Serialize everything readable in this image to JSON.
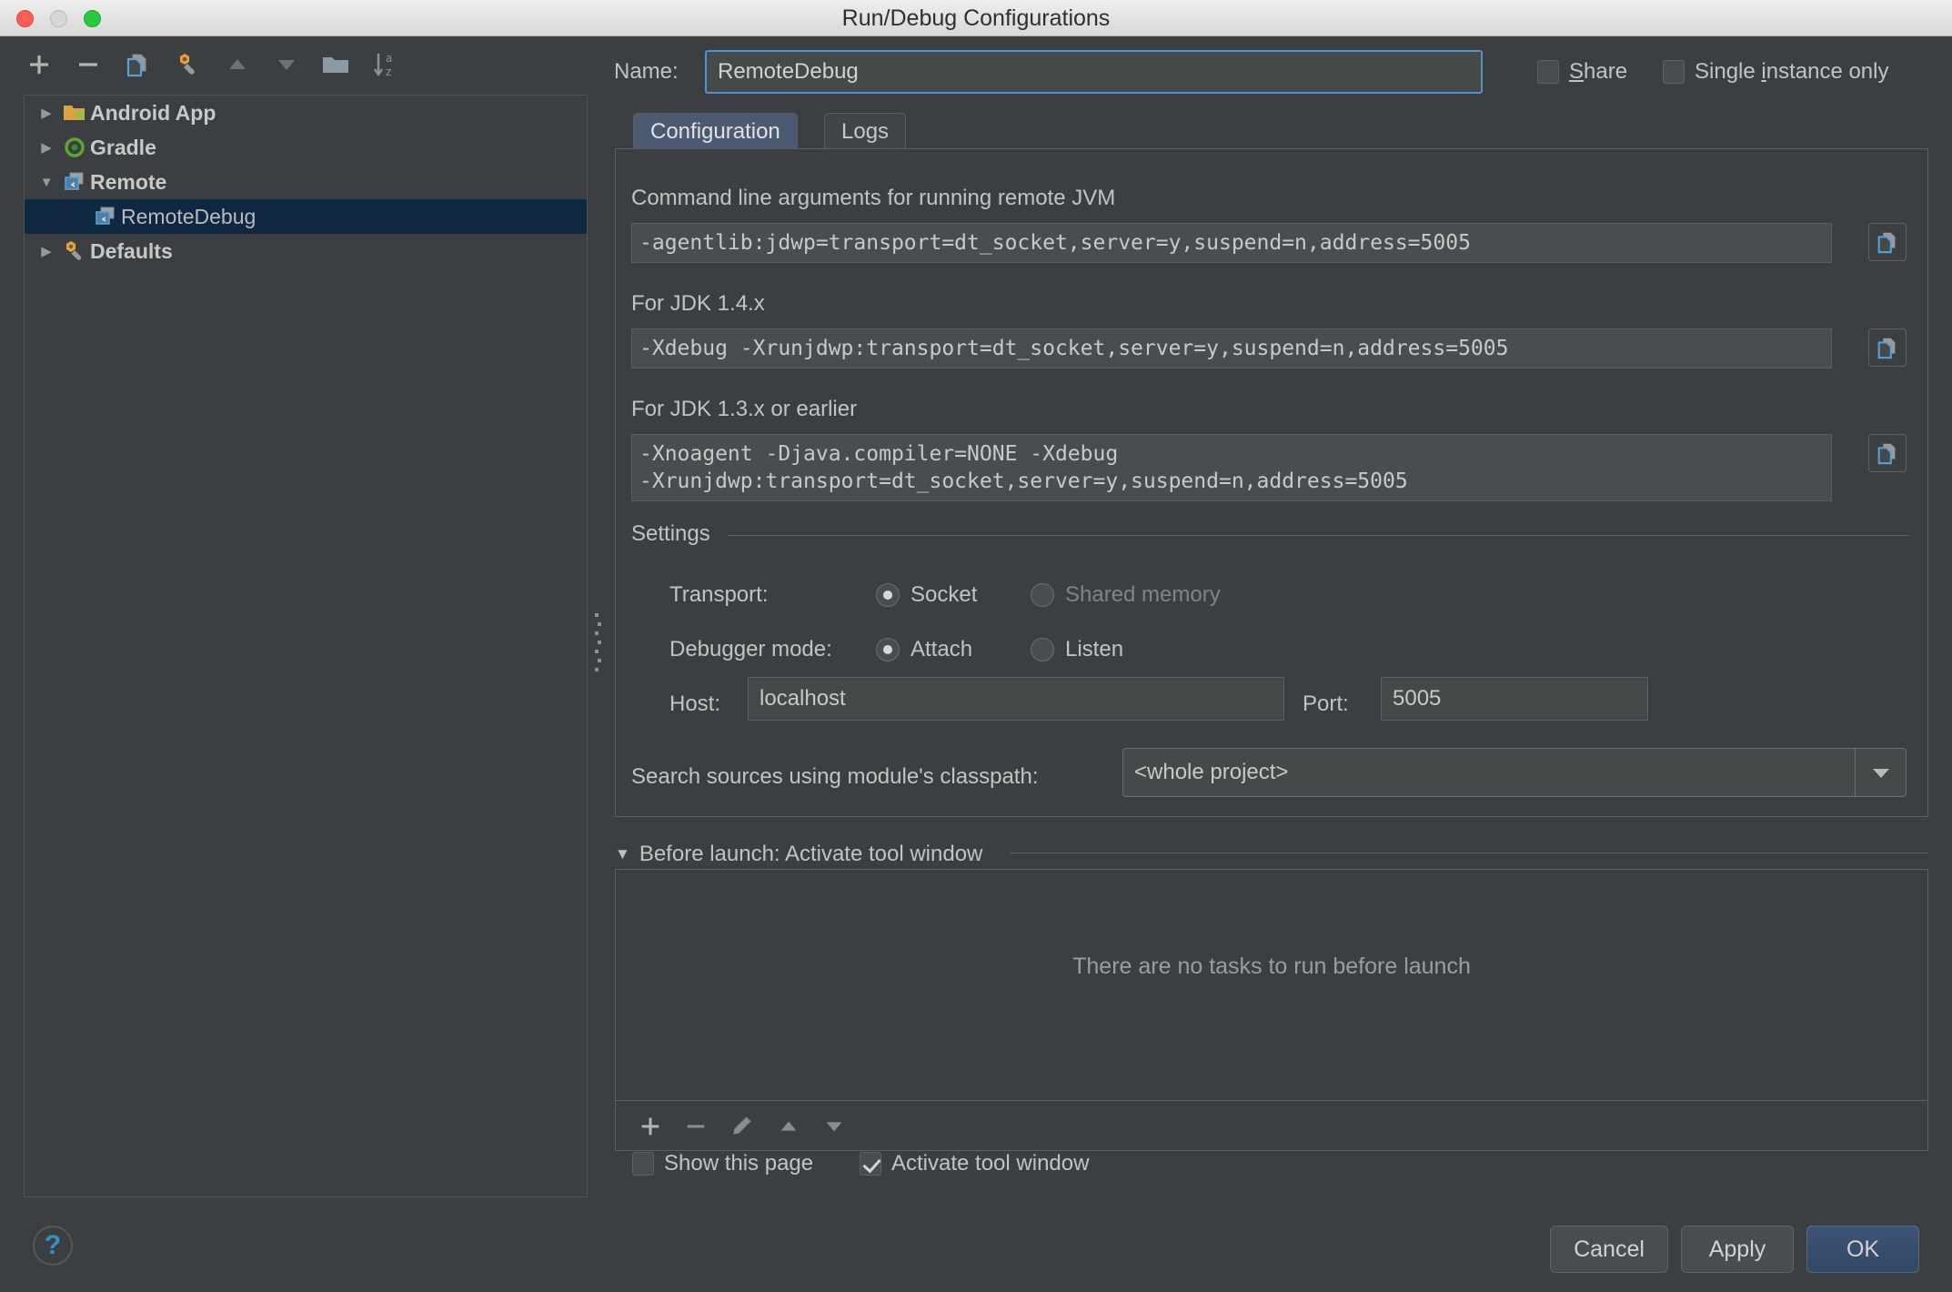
{
  "window": {
    "title": "Run/Debug Configurations",
    "traffic_lights": [
      "close",
      "minimize",
      "maximize"
    ]
  },
  "sidebar": {
    "toolbar": [
      {
        "name": "add-configuration-button",
        "icon": "plus-icon"
      },
      {
        "name": "remove-configuration-button",
        "icon": "minus-icon"
      },
      {
        "name": "copy-configuration-button",
        "icon": "copy-icon"
      },
      {
        "name": "edit-defaults-button",
        "icon": "wrench-icon"
      },
      {
        "name": "move-up-button",
        "icon": "arrow-up-icon"
      },
      {
        "name": "move-down-button",
        "icon": "arrow-down-icon"
      },
      {
        "name": "new-folder-button",
        "icon": "folder-icon"
      },
      {
        "name": "sort-button",
        "icon": "sort-az-icon"
      }
    ],
    "tree": [
      {
        "label": "Android App",
        "icon": "android-app-icon",
        "expanded": false,
        "level": 0,
        "bold": true,
        "selected": false
      },
      {
        "label": "Gradle",
        "icon": "gradle-icon",
        "expanded": false,
        "level": 0,
        "bold": true,
        "selected": false
      },
      {
        "label": "Remote",
        "icon": "remote-icon",
        "expanded": true,
        "level": 0,
        "bold": true,
        "selected": false
      },
      {
        "label": "RemoteDebug",
        "icon": "remote-icon",
        "expanded": null,
        "level": 1,
        "bold": false,
        "selected": true
      },
      {
        "label": "Defaults",
        "icon": "wrench-icon",
        "expanded": false,
        "level": 0,
        "bold": true,
        "selected": false
      }
    ]
  },
  "header": {
    "name_label": "Name:",
    "name_value": "RemoteDebug",
    "share_label": "Share",
    "share_mnemonic": "S",
    "share_checked": false,
    "single_instance_label": "Single instance only",
    "single_instance_mnemonic": "i",
    "single_instance_checked": false
  },
  "tabs": [
    {
      "label": "Configuration",
      "active": true
    },
    {
      "label": "Logs",
      "active": false
    }
  ],
  "configuration": {
    "cmdline_label": "Command line arguments for running remote JVM",
    "cmdline_value": "-agentlib:jdwp=transport=dt_socket,server=y,suspend=n,address=5005",
    "jdk14_label": "For JDK 1.4.x",
    "jdk14_value": "-Xdebug -Xrunjdwp:transport=dt_socket,server=y,suspend=n,address=5005",
    "jdk13_label": "For JDK 1.3.x or earlier",
    "jdk13_value": "-Xnoagent -Djava.compiler=NONE -Xdebug\n-Xrunjdwp:transport=dt_socket,server=y,suspend=n,address=5005",
    "copy_icon": "copy-to-clipboard-icon",
    "settings_title": "Settings",
    "transport_label": "Transport:",
    "transport_options": [
      {
        "label": "Socket",
        "selected": true,
        "disabled": false
      },
      {
        "label": "Shared memory",
        "selected": false,
        "disabled": true
      }
    ],
    "debugger_mode_label": "Debugger mode:",
    "debugger_mode_options": [
      {
        "label": "Attach",
        "selected": true,
        "disabled": false
      },
      {
        "label": "Listen",
        "selected": false,
        "disabled": false
      }
    ],
    "host_label": "Host:",
    "host_value": "localhost",
    "port_label": "Port:",
    "port_value": "5005",
    "classpath_label": "Search sources using module's classpath:",
    "classpath_value": "<whole project>",
    "classpath_arrow": "chevron-down-icon"
  },
  "before_launch": {
    "title": "Before launch: Activate tool window",
    "collapse_icon": "triangle-down-icon",
    "empty_text": "There are no tasks to run before launch",
    "toolbar": [
      {
        "name": "add-task-button",
        "icon": "plus-icon"
      },
      {
        "name": "remove-task-button",
        "icon": "minus-icon"
      },
      {
        "name": "edit-task-button",
        "icon": "pencil-icon"
      },
      {
        "name": "move-task-up-button",
        "icon": "arrow-up-icon"
      },
      {
        "name": "move-task-down-button",
        "icon": "arrow-down-icon"
      }
    ],
    "show_page_label": "Show this page",
    "show_page_checked": false,
    "activate_window_label": "Activate tool window",
    "activate_window_checked": true
  },
  "footer": {
    "help_icon": "question-mark-icon",
    "cancel_label": "Cancel",
    "apply_label": "Apply",
    "ok_label": "OK"
  },
  "colors": {
    "background": "#3c3f41",
    "accent_blue": "#5394c8",
    "selection": "#0d2840",
    "primary_button": "#3e5573",
    "text": "#c3c3c3"
  }
}
